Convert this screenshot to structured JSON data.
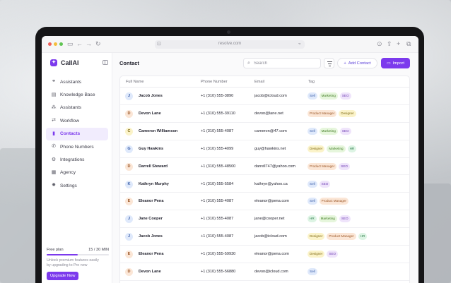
{
  "browser": {
    "url": "resolve.com"
  },
  "app": {
    "name": "CallAI"
  },
  "sidebar": {
    "items": [
      {
        "label": "Assistants",
        "icon": "assistants-icon",
        "glyph": "⚭",
        "active": false
      },
      {
        "label": "Knowledge Base",
        "icon": "book-icon",
        "glyph": "▤",
        "active": false
      },
      {
        "label": "Assistants",
        "icon": "nodes-icon",
        "glyph": "⁂",
        "active": false
      },
      {
        "label": "Workflow",
        "icon": "workflow-icon",
        "glyph": "⇄",
        "active": false
      },
      {
        "label": "Contacts",
        "icon": "contacts-icon",
        "glyph": "▮",
        "active": true
      },
      {
        "label": "Phone Numbers",
        "icon": "phone-icon",
        "glyph": "✆",
        "active": false
      },
      {
        "label": "Integrations",
        "icon": "integrations-icon",
        "glyph": "⚙",
        "active": false
      },
      {
        "label": "Agency",
        "icon": "agency-icon",
        "glyph": "▦",
        "active": false
      },
      {
        "label": "Settings",
        "icon": "settings-icon",
        "glyph": "✹",
        "active": false
      }
    ],
    "plan": {
      "label": "Free plan",
      "usage": "15 / 30 MIN",
      "fraction": 0.5,
      "description": "Unlock premium features easily by upgrading to Pro now",
      "upgrade_label": "Upgrade Now"
    }
  },
  "main": {
    "title": "Contact",
    "search_placeholder": "Search",
    "add_label": "Add Contact",
    "import_label": "Import",
    "columns": [
      "Full Name",
      "Phone Number",
      "Email",
      "Tag"
    ]
  },
  "contacts": [
    {
      "initial": "J",
      "name": "Jacob Jones",
      "phone": "+1 (310) 555-3890",
      "email": "jacob@icloud.com",
      "tags": [
        "Sell",
        "Marketing",
        "SEO"
      ]
    },
    {
      "initial": "D",
      "name": "Devon Lane",
      "phone": "+1 (310) 555-39110",
      "email": "devon@lane.net",
      "tags": [
        "Product Manager",
        "Designer"
      ]
    },
    {
      "initial": "C",
      "name": "Cameron Williamson",
      "phone": "+1 (310) 555-4087",
      "email": "cameron@47.com",
      "tags": [
        "Sell",
        "Marketing",
        "SEO"
      ]
    },
    {
      "initial": "G",
      "name": "Guy Hawkins",
      "phone": "+1 (310) 555-4099",
      "email": "guy@hawkins.net",
      "tags": [
        "Designer",
        "Marketing",
        "HR"
      ]
    },
    {
      "initial": "D",
      "name": "Darrell Steward",
      "phone": "+1 (310) 555-48500",
      "email": "darrell747@yahoo.com",
      "tags": [
        "Product Manager",
        "SEO"
      ]
    },
    {
      "initial": "K",
      "name": "Kathryn Murphy",
      "phone": "+1 (310) 555-5584",
      "email": "kathryn@yahoo.ca",
      "tags": [
        "Sell",
        "SEO"
      ]
    },
    {
      "initial": "E",
      "name": "Eleanor Pena",
      "phone": "+1 (310) 555-4087",
      "email": "eleanor@pena.com",
      "tags": [
        "Sell",
        "Product Manager"
      ]
    },
    {
      "initial": "J",
      "name": "Jane Cooper",
      "phone": "+1 (310) 555-4087",
      "email": "jane@cooper.net",
      "tags": [
        "HR",
        "Marketing",
        "SEO"
      ]
    },
    {
      "initial": "J",
      "name": "Jacob Jones",
      "phone": "+1 (310) 555-4087",
      "email": "jacob@icloud.com",
      "tags": [
        "Designer",
        "Product Manager",
        "HR"
      ]
    },
    {
      "initial": "E",
      "name": "Eleanor Pena",
      "phone": "+1 (310) 555-59930",
      "email": "eleanor@pena.com",
      "tags": [
        "Designer",
        "SEO"
      ]
    },
    {
      "initial": "D",
      "name": "Devon Lane",
      "phone": "+1 (310) 555-56880",
      "email": "devon@icloud.com",
      "tags": [
        "Sell"
      ]
    }
  ],
  "colors": {
    "accent": "#7c3aed",
    "tags": {
      "Sell": [
        "#dfe9fb",
        "#3a5ea8"
      ],
      "Marketing": [
        "#e6f6dc",
        "#3f7a22"
      ],
      "SEO": [
        "#efe4fb",
        "#6b3ab1"
      ],
      "Product Manager": [
        "#fbe6d6",
        "#9a5626"
      ],
      "Designer": [
        "#fbf3c9",
        "#7f6913"
      ],
      "HR": [
        "#ddf4e4",
        "#2c7a48"
      ]
    },
    "avatars": {
      "J": [
        "#dfe9fb",
        "#3a5ea8"
      ],
      "D": [
        "#fbe6d6",
        "#9a5626"
      ],
      "C": [
        "#fbf3c9",
        "#7f6913"
      ],
      "G": [
        "#dfe9fb",
        "#3a5ea8"
      ],
      "K": [
        "#dfe9fb",
        "#3a5ea8"
      ],
      "E": [
        "#fbe6d6",
        "#9a5626"
      ]
    }
  }
}
